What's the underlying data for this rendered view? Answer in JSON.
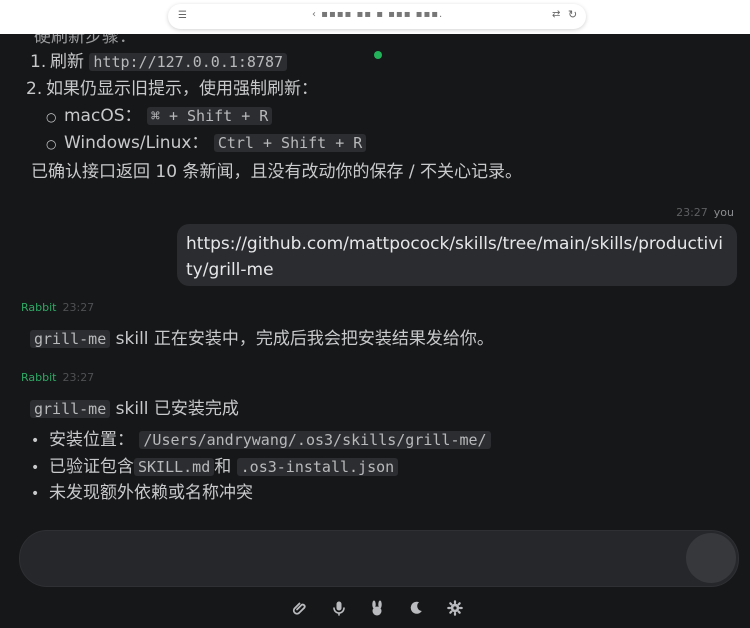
{
  "browser": {
    "url_masked": "‹ ▪▪▪▪ ▪▪ ▪ ▪▪▪ ▪▪▪.",
    "icons": [
      "tab-list-icon",
      "translate-icon",
      "reload-icon"
    ]
  },
  "chat": {
    "top_partial": "硬刷新步骤：",
    "steps": [
      {
        "num": "1.",
        "text": "刷新",
        "code": "http://127.0.0.1:8787"
      },
      {
        "num": "2.",
        "text": "如果仍显示旧提示，使用强制刷新："
      }
    ],
    "shortcuts": [
      {
        "label": "macOS：",
        "code": "⌘ + Shift + R"
      },
      {
        "label": "Windows/Linux：",
        "code": "Ctrl + Shift + R"
      }
    ],
    "confirm_line": "已确认接口返回 10 条新闻，且没有改动你的保存 / 不关心记录。",
    "user_meta": {
      "time": "23:27",
      "who": "you"
    },
    "user_message": "https://github.com/mattpocock/skills/tree/main/skills/productivity/grill-me",
    "bot_msg1": {
      "sender": "Rabbit",
      "time": "23:27",
      "code": "grill-me",
      "text": " skill 正在安装中，完成后我会把安装结果发给你。"
    },
    "bot_msg2": {
      "sender": "Rabbit",
      "time": "23:27",
      "code": "grill-me",
      "text": " skill 已安装完成",
      "bullets": [
        {
          "pre": "安装位置：",
          "code1": "/Users/andrywang/.os3/skills/grill-me/"
        },
        {
          "pre": "已验证包含",
          "code1": "SKILL.md",
          "mid": "和",
          "code2": ".os3-install.json"
        },
        {
          "pre": "未发现额外依赖或名称冲突"
        }
      ]
    }
  },
  "composer": {
    "placeholder": "",
    "toolbar": [
      "attach-icon",
      "mic-icon",
      "rabbit-icon",
      "moon-icon",
      "gear-icon"
    ]
  },
  "colors": {
    "background": "#161718",
    "bubble": "#2a2c30",
    "accent_green": "#2fa865",
    "code_bg": "#2b2d30"
  }
}
